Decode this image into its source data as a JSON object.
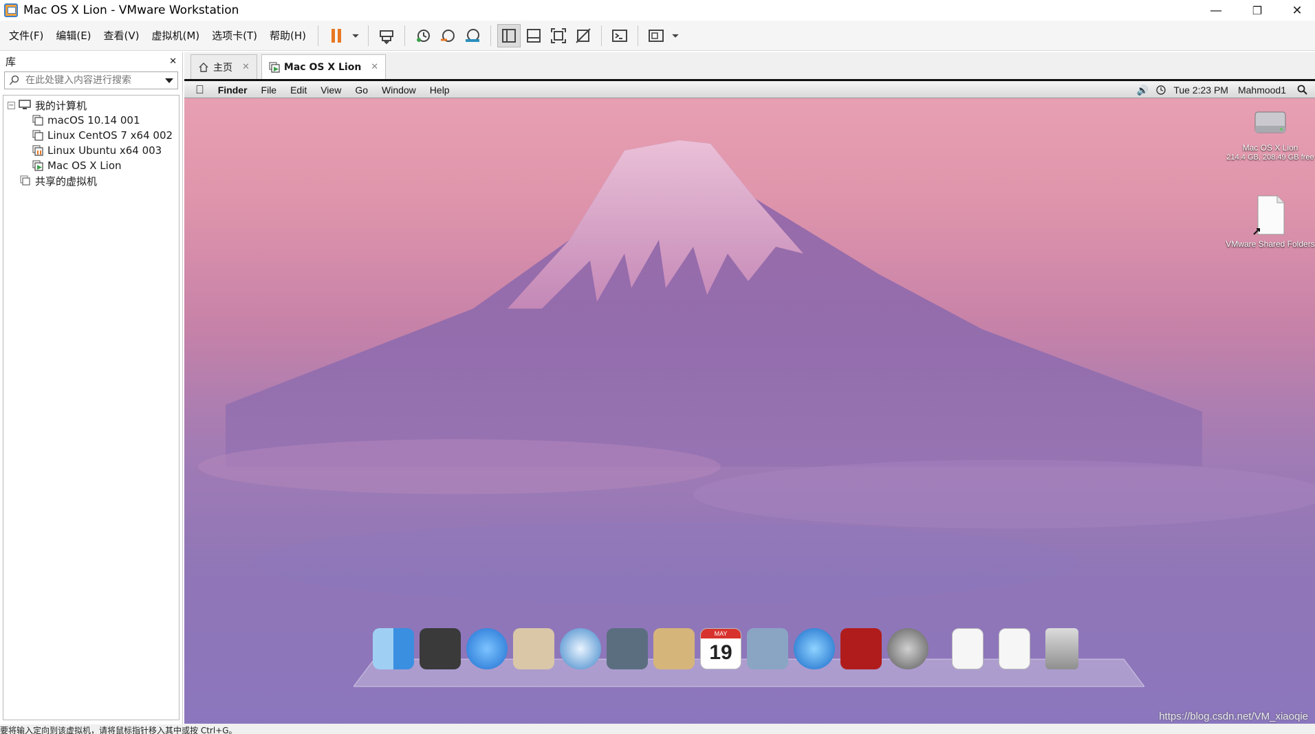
{
  "window": {
    "title": "Mac OS X Lion - VMware Workstation",
    "minimize": "—",
    "restore": "❐",
    "close": "✕"
  },
  "menubar": {
    "items": [
      "文件(F)",
      "编辑(E)",
      "查看(V)",
      "虚拟机(M)",
      "选项卡(T)",
      "帮助(H)"
    ]
  },
  "toolbar": {
    "icons": [
      "pause-icon",
      "dropdown-icon",
      "send-ctrl-alt-del-icon",
      "snapshot-icon",
      "revert-snapshot-icon",
      "snapshot-manager-icon",
      "library-view-icon",
      "thumbnail-view-icon",
      "fullscreen-icon",
      "unity-icon",
      "console-icon",
      "stretch-view-icon",
      "dropdown-icon"
    ],
    "accent": "#e87722"
  },
  "library": {
    "title": "库",
    "close": "✕",
    "search_placeholder": "在此处键入内容进行搜索",
    "root": "我的计算机",
    "vms": [
      "macOS 10.14 001",
      "Linux CentOS 7 x64 002",
      "Linux Ubuntu x64 003",
      "Mac OS X Lion"
    ],
    "shared": "共享的虚拟机"
  },
  "tabs": [
    {
      "label": "主页",
      "close": "✕"
    },
    {
      "label": "Mac OS X Lion",
      "close": "✕"
    }
  ],
  "mac": {
    "menu": [
      "Finder",
      "File",
      "Edit",
      "View",
      "Go",
      "Window",
      "Help"
    ],
    "clock": "Tue 2:23 PM",
    "user": "Mahmood1",
    "desktop_icons": [
      {
        "name": "Mac OS X Lion",
        "sub": "214.4 GB, 208.49 GB free"
      },
      {
        "name": "VMware Shared Folders",
        "sub": ""
      }
    ],
    "calendar_month": "MAY",
    "calendar_day": "19"
  },
  "statusbar": {
    "text": "要将输入定向到该虚拟机，请将鼠标指针移入其中或按 Ctrl+G。"
  },
  "watermark": "https://blog.csdn.net/VM_xiaoqie"
}
